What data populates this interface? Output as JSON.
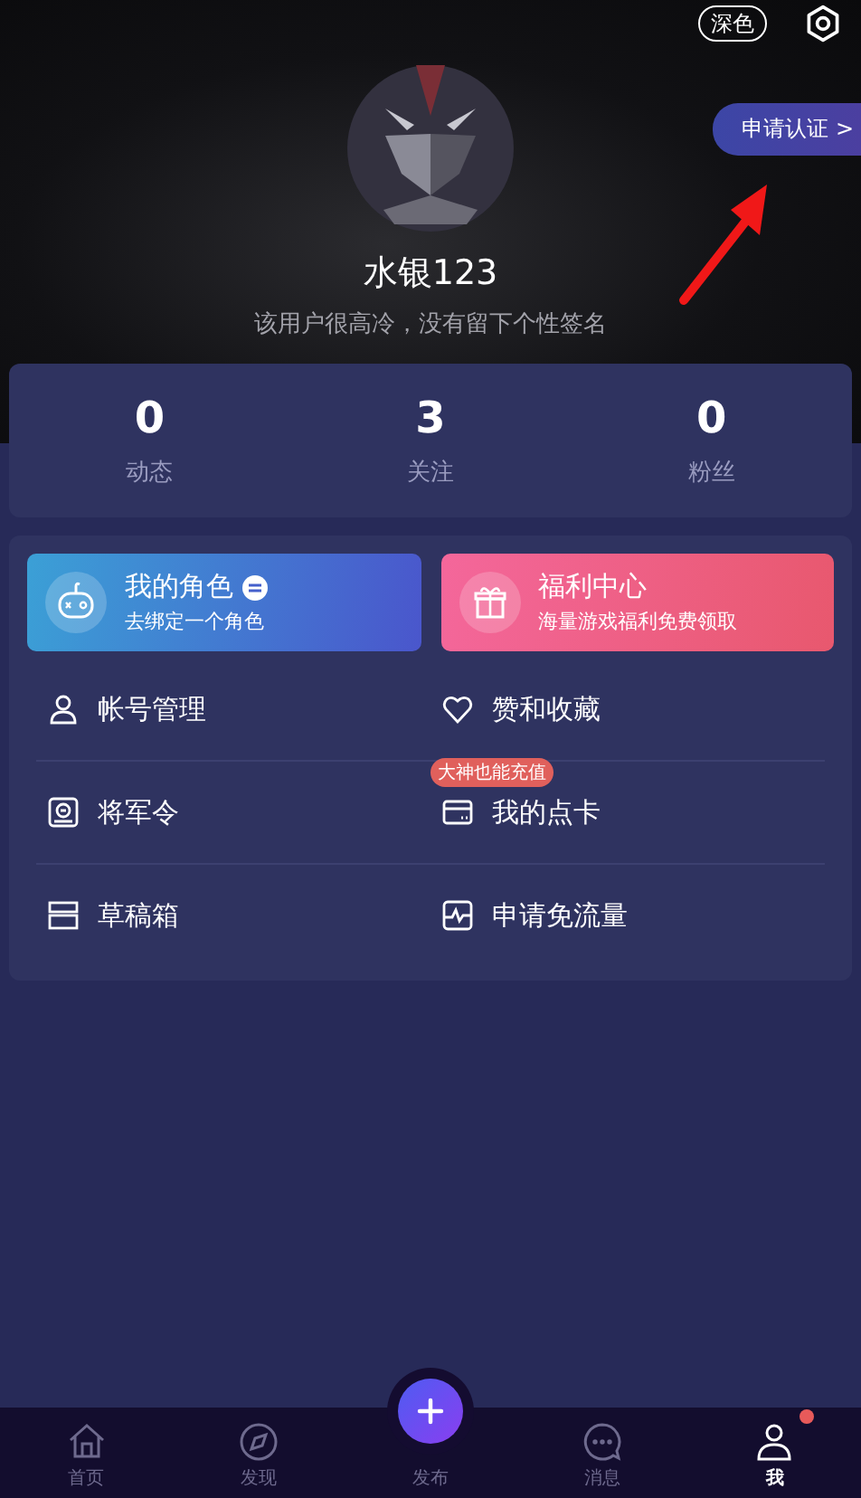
{
  "header": {
    "theme_button": "深色",
    "certify_button": "申请认证",
    "certify_chevron": ">",
    "username": "水银123",
    "signature": "该用户很高冷，没有留下个性签名"
  },
  "stats": [
    {
      "value": "0",
      "label": "动态"
    },
    {
      "value": "3",
      "label": "关注"
    },
    {
      "value": "0",
      "label": "粉丝"
    }
  ],
  "feature_cards": [
    {
      "kind": "role",
      "title": "我的角色",
      "subtitle": "去绑定一个角色"
    },
    {
      "kind": "gift",
      "title": "福利中心",
      "subtitle": "海量游戏福利免费领取"
    }
  ],
  "menu": [
    {
      "kind": "person",
      "label": "帐号管理"
    },
    {
      "kind": "heart",
      "label": "赞和收藏"
    },
    {
      "kind": "token",
      "label": "将军令"
    },
    {
      "kind": "card",
      "label": "我的点卡",
      "badge": "大神也能充值"
    },
    {
      "kind": "drafts",
      "label": "草稿箱"
    },
    {
      "kind": "pulse",
      "label": "申请免流量"
    }
  ],
  "tab_bar": [
    {
      "kind": "home",
      "label": "首页",
      "selected": false,
      "dot": false
    },
    {
      "kind": "compass",
      "label": "发现",
      "selected": false,
      "dot": false
    },
    {
      "kind": "publish",
      "label": "发布",
      "selected": false,
      "dot": false
    },
    {
      "kind": "chat",
      "label": "消息",
      "selected": false,
      "dot": false
    },
    {
      "kind": "person",
      "label": "我",
      "selected": true,
      "dot": true
    }
  ]
}
